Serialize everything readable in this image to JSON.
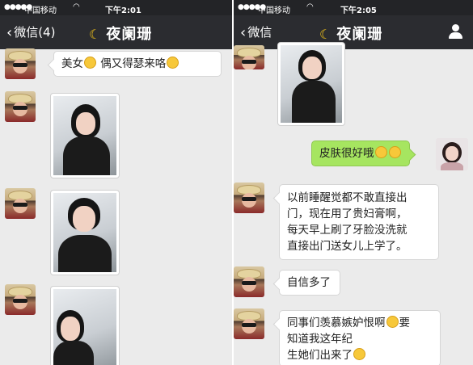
{
  "left": {
    "status": {
      "signal": "●●●●●",
      "carrier": "中国移动",
      "time": "下午2:01"
    },
    "nav": {
      "back_label": "微信(4)",
      "title": "夜阑珊"
    },
    "messages": [
      {
        "type": "text",
        "text_before": "美女",
        "text_mid": " 偶又得瑟来咯",
        "emoji_count": 2
      }
    ]
  },
  "right": {
    "status": {
      "signal": "●●●●●",
      "carrier": "中国移动",
      "time": "下午2:05"
    },
    "nav": {
      "back_label": "微信",
      "title": "夜阑珊"
    },
    "messages": [
      {
        "type": "text",
        "sender": "me",
        "text": "皮肤很好哦"
      },
      {
        "type": "text",
        "sender": "other",
        "lines": [
          "以前睡醒觉都不敢直接出",
          "门，现在用了贵妇膏啊，",
          "每天早上刷了牙脸没洗就",
          "直接出门送女儿上学了。"
        ]
      },
      {
        "type": "text",
        "sender": "other",
        "text": "自信多了"
      },
      {
        "type": "text",
        "sender": "other",
        "lines": [
          "同事们羡慕嫉妒恨啊",
          "要",
          "知道我这年纪",
          "生她们出来了"
        ]
      }
    ]
  },
  "icons": {
    "back": "chevron-left-icon",
    "moon": "moon-icon",
    "person": "person-icon",
    "emoji": "smiley-emoji-icon"
  },
  "colors": {
    "navbar": "#2b2c30",
    "statusbar": "#232427",
    "chat_bg": "#ebebeb",
    "bubble_self": "#a6e560",
    "moon": "#f5c518"
  }
}
